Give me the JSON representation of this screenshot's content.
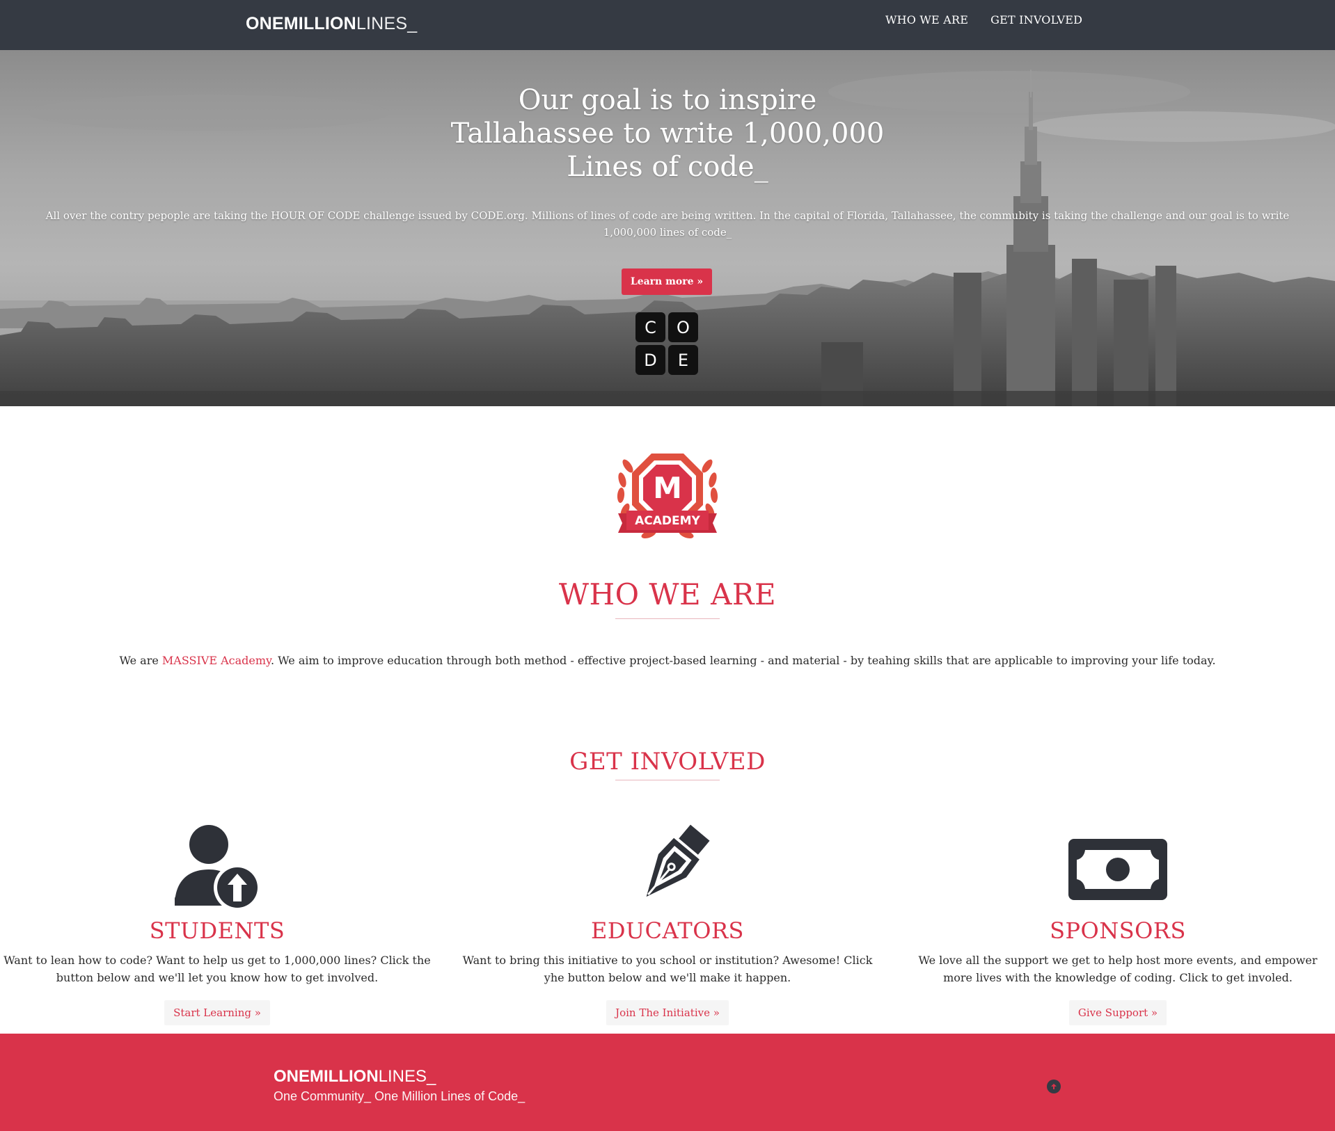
{
  "navbar": {
    "brand_bold": "ONEMILLION",
    "brand_light": "LINES_",
    "links": [
      "WHO WE ARE",
      "GET INVOLVED"
    ]
  },
  "hero": {
    "title_lines": [
      "Our goal is to inspire",
      "Tallahassee to write 1,000,000",
      "Lines of code_"
    ],
    "text": "All over the contry pepople are taking the HOUR OF CODE challenge issued by CODE.org. Millions of lines of code are being written. In the capital of Florida, Tallahassee, the commubity is taking the challenge and our goal is to write 1,000,000 lines of code_",
    "button": "Learn more »",
    "code_letters": [
      "C",
      "O",
      "D",
      "E"
    ]
  },
  "logo": {
    "letter": "M",
    "ribbon": "ACADEMY"
  },
  "who": {
    "title": "WHO WE ARE",
    "text_before": "We are ",
    "link": "MASSIVE Academy",
    "text_after": ". We aim to improve education through both method - effective project-based learning - and material - by teahing skills that are applicable to improving your life today."
  },
  "get_involved": {
    "title": "GET INVOLVED",
    "cards": [
      {
        "icon": "user-upload-icon",
        "title": "STUDENTS",
        "text": "Want to lean how to code? Want to help us get to 1,000,000 lines? Click the button below and we'll let you know how to get involved.",
        "button": "Start Learning »"
      },
      {
        "icon": "pen-nib-icon",
        "title": "EDUCATORS",
        "text": "Want to bring this initiative to you school or institution? Awesome! Click yhe button below and we'll make it happen.",
        "button": "Join The Initiative »"
      },
      {
        "icon": "money-bill-icon",
        "title": "SPONSORS",
        "text": "We love all the support we get to help host more events, and empower more lives with the knowledge of coding. Click to get involed.",
        "button": "Give Support »"
      }
    ]
  },
  "footer": {
    "brand_bold": "ONEMILLION",
    "brand_light": "LINES_",
    "tagline": "One Community_ One Million Lines of Code_"
  },
  "colors": {
    "accent": "#d9334a",
    "navbar": "#353a43",
    "icon_dark": "#2e3138"
  }
}
